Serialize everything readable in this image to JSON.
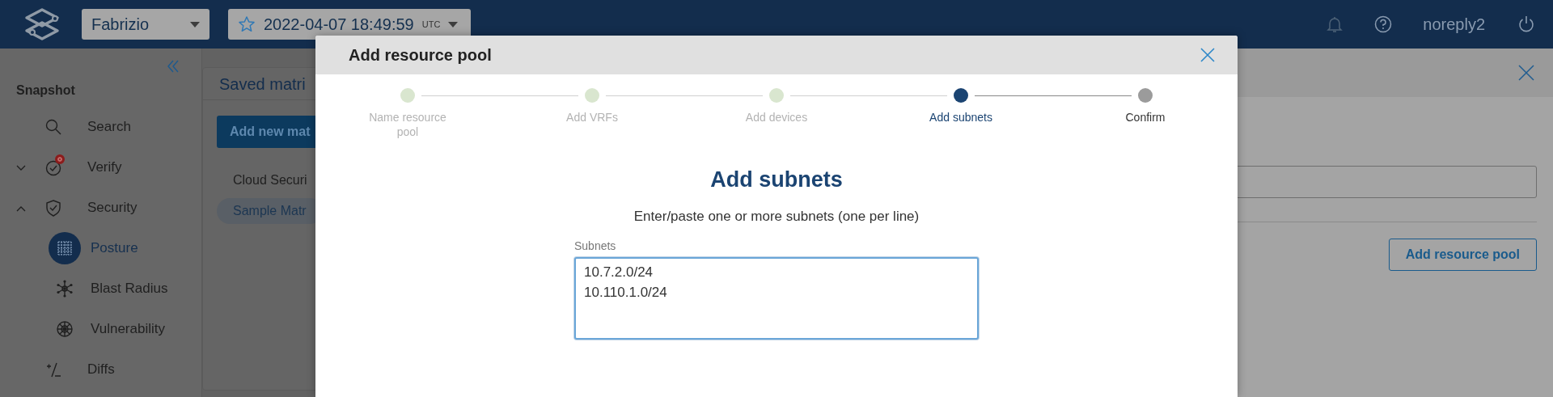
{
  "top_bar": {
    "workspace": "Fabrizio",
    "snapshot": {
      "date": "2022-04-07 18:49:59",
      "zone": "UTC",
      "favorite": false
    },
    "user": "noreply2"
  },
  "sidebar": {
    "section": "Snapshot",
    "items": [
      {
        "label": "Search",
        "kind": "link",
        "alert": false
      },
      {
        "label": "Verify",
        "kind": "group",
        "expanded": false,
        "alert": true
      },
      {
        "label": "Security",
        "kind": "group",
        "expanded": true,
        "alert": false,
        "children": [
          {
            "label": "Posture",
            "selected": true
          },
          {
            "label": "Blast Radius",
            "selected": false
          },
          {
            "label": "Vulnerability",
            "selected": false
          }
        ]
      },
      {
        "label": "Diffs",
        "kind": "link",
        "alert": false
      }
    ]
  },
  "main": {
    "card_title": "Saved matri",
    "add_button": "Add new mat",
    "matrices": [
      {
        "label": "Cloud Securi",
        "selected": false
      },
      {
        "label": "Sample Matr",
        "selected": true
      }
    ]
  },
  "drawer": {
    "button": "Add resource pool"
  },
  "modal": {
    "title": "Add resource pool",
    "steps": [
      {
        "label": "Name resource pool",
        "completed": true,
        "selected": false
      },
      {
        "label": "Add VRFs",
        "completed": true,
        "selected": false
      },
      {
        "label": "Add devices",
        "completed": true,
        "selected": false
      },
      {
        "label": "Add subnets",
        "completed": false,
        "selected": true
      },
      {
        "label": "Confirm",
        "completed": false,
        "selected": false
      }
    ],
    "heading": "Add subnets",
    "instructions": "Enter/paste one or more subnets (one per line)",
    "field": {
      "label": "Subnets",
      "value": "10.7.2.0/24\n10.110.1.0/24"
    }
  }
}
